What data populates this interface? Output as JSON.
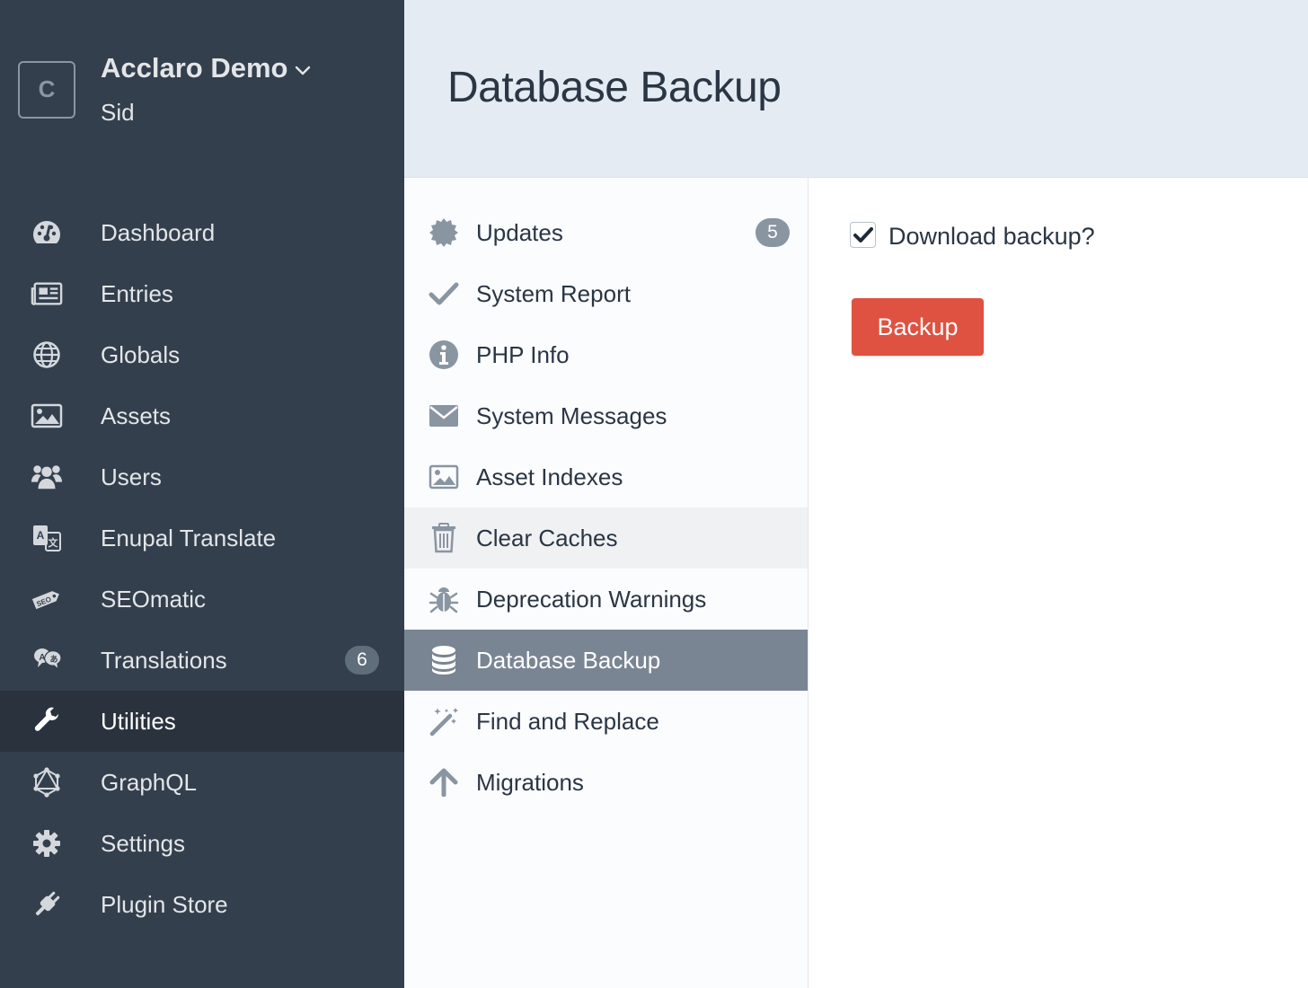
{
  "site": {
    "logo_letter": "C",
    "name": "Acclaro Demo",
    "user": "Sid"
  },
  "nav": {
    "items": [
      {
        "label": "Dashboard",
        "icon": "gauge-icon"
      },
      {
        "label": "Entries",
        "icon": "newspaper-icon"
      },
      {
        "label": "Globals",
        "icon": "globe-icon"
      },
      {
        "label": "Assets",
        "icon": "image-icon"
      },
      {
        "label": "Users",
        "icon": "users-icon"
      },
      {
        "label": "Enupal Translate",
        "icon": "translate-icon"
      },
      {
        "label": "SEOmatic",
        "icon": "seo-tag-icon"
      },
      {
        "label": "Translations",
        "icon": "speech-bubbles-icon",
        "badge": "6"
      },
      {
        "label": "Utilities",
        "icon": "wrench-icon",
        "active": true
      },
      {
        "label": "GraphQL",
        "icon": "graphql-icon"
      },
      {
        "label": "Settings",
        "icon": "gear-icon"
      },
      {
        "label": "Plugin Store",
        "icon": "plug-icon"
      }
    ]
  },
  "page": {
    "title": "Database Backup"
  },
  "subnav": {
    "items": [
      {
        "label": "Updates",
        "icon": "badge-icon",
        "badge": "5"
      },
      {
        "label": "System Report",
        "icon": "check-icon"
      },
      {
        "label": "PHP Info",
        "icon": "info-icon"
      },
      {
        "label": "System Messages",
        "icon": "envelope-icon"
      },
      {
        "label": "Asset Indexes",
        "icon": "image-icon"
      },
      {
        "label": "Clear Caches",
        "icon": "trash-icon",
        "hover": true
      },
      {
        "label": "Deprecation Warnings",
        "icon": "bug-icon"
      },
      {
        "label": "Database Backup",
        "icon": "database-icon",
        "active": true
      },
      {
        "label": "Find and Replace",
        "icon": "magic-wand-icon"
      },
      {
        "label": "Migrations",
        "icon": "arrow-up-icon"
      }
    ]
  },
  "content": {
    "checkbox_label": "Download backup?",
    "checkbox_checked": true,
    "button_label": "Backup"
  },
  "colors": {
    "sidebar_bg": "#333f4d",
    "sidebar_active": "#29323d",
    "header_bg": "#e4ebf3",
    "subnav_active": "#7a8593",
    "primary_button": "#df5141"
  }
}
